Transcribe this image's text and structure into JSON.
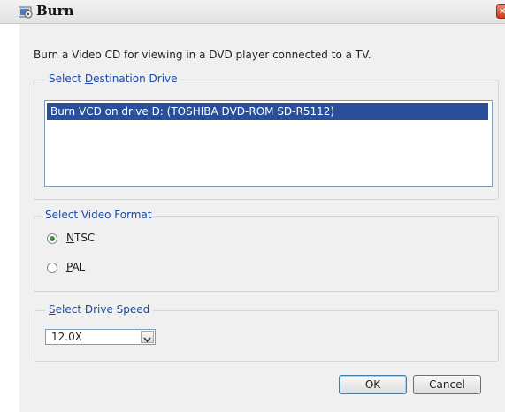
{
  "window": {
    "title": "Burn"
  },
  "description": "Burn a Video CD for viewing in a DVD player connected to a TV.",
  "destination": {
    "legend_pre": "Select ",
    "legend_key": "D",
    "legend_post": "estination Drive",
    "items": [
      "Burn VCD on drive D: (TOSHIBA DVD-ROM SD-R5112)"
    ]
  },
  "video_format": {
    "legend": "Select Video Format",
    "options": [
      {
        "key": "N",
        "rest": "TSC",
        "selected": true
      },
      {
        "key": "P",
        "rest": "AL",
        "selected": false
      }
    ]
  },
  "drive_speed": {
    "legend_key": "S",
    "legend_rest": "elect Drive Speed",
    "value": "12.0X"
  },
  "buttons": {
    "ok": "OK",
    "cancel": "Cancel"
  },
  "colors": {
    "selection": "#2a4f9a",
    "legend_text": "#1a4ba8",
    "radio_dot": "#3f8f3f"
  },
  "icons": {
    "title": "burn-disc-icon",
    "close": "close-icon",
    "dropdown": "chevron-down-icon"
  }
}
